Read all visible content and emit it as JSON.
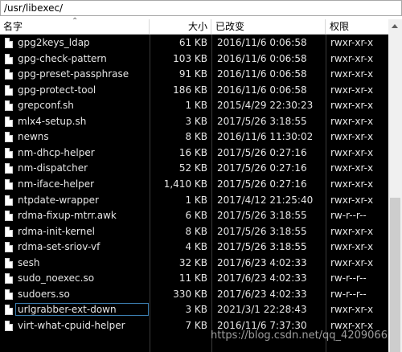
{
  "path": "/usr/libexec/",
  "columns": {
    "name": "名字",
    "size": "大小",
    "modified": "已改变",
    "perms": "权限"
  },
  "files": [
    {
      "name": "gpg2keys_ldap",
      "size": "61 KB",
      "modified": "2016/11/6 0:06:58",
      "perms": "rwxr-xr-x"
    },
    {
      "name": "gpg-check-pattern",
      "size": "103 KB",
      "modified": "2016/11/6 0:06:58",
      "perms": "rwxr-xr-x"
    },
    {
      "name": "gpg-preset-passphrase",
      "size": "91 KB",
      "modified": "2016/11/6 0:06:58",
      "perms": "rwxr-xr-x"
    },
    {
      "name": "gpg-protect-tool",
      "size": "186 KB",
      "modified": "2016/11/6 0:06:58",
      "perms": "rwxr-xr-x"
    },
    {
      "name": "grepconf.sh",
      "size": "1 KB",
      "modified": "2015/4/29 22:30:23",
      "perms": "rwxr-xr-x"
    },
    {
      "name": "mlx4-setup.sh",
      "size": "3 KB",
      "modified": "2017/5/26 3:18:55",
      "perms": "rwxr-xr-x"
    },
    {
      "name": "newns",
      "size": "8 KB",
      "modified": "2016/11/6 11:30:02",
      "perms": "rwxr-xr-x"
    },
    {
      "name": "nm-dhcp-helper",
      "size": "16 KB",
      "modified": "2017/5/26 0:27:16",
      "perms": "rwxr-xr-x"
    },
    {
      "name": "nm-dispatcher",
      "size": "52 KB",
      "modified": "2017/5/26 0:27:16",
      "perms": "rwxr-xr-x"
    },
    {
      "name": "nm-iface-helper",
      "size": "1,410 KB",
      "modified": "2017/5/26 0:27:16",
      "perms": "rwxr-xr-x"
    },
    {
      "name": "ntpdate-wrapper",
      "size": "1 KB",
      "modified": "2017/4/12 21:25:40",
      "perms": "rwxr-xr-x"
    },
    {
      "name": "rdma-fixup-mtrr.awk",
      "size": "6 KB",
      "modified": "2017/5/26 3:18:55",
      "perms": "rw-r--r--"
    },
    {
      "name": "rdma-init-kernel",
      "size": "8 KB",
      "modified": "2017/5/26 3:18:55",
      "perms": "rwxr-xr-x"
    },
    {
      "name": "rdma-set-sriov-vf",
      "size": "4 KB",
      "modified": "2017/5/26 3:18:55",
      "perms": "rwxr-xr-x"
    },
    {
      "name": "sesh",
      "size": "32 KB",
      "modified": "2017/6/23 4:02:33",
      "perms": "rwxr-xr-x"
    },
    {
      "name": "sudo_noexec.so",
      "size": "11 KB",
      "modified": "2017/6/23 4:02:33",
      "perms": "rw-r--r--"
    },
    {
      "name": "sudoers.so",
      "size": "330 KB",
      "modified": "2017/6/23 4:02:33",
      "perms": "rw-r--r--"
    },
    {
      "name": "urlgrabber-ext-down",
      "size": "3 KB",
      "modified": "2021/3/1 22:28:43",
      "perms": "rwxr-xr-x",
      "selected": true
    },
    {
      "name": "virt-what-cpuid-helper",
      "size": "7 KB",
      "modified": "2016/11/6 7:37:30",
      "perms": "rwxr-xr-x"
    }
  ],
  "watermark": "https://blog.csdn.net/qq_4209066"
}
